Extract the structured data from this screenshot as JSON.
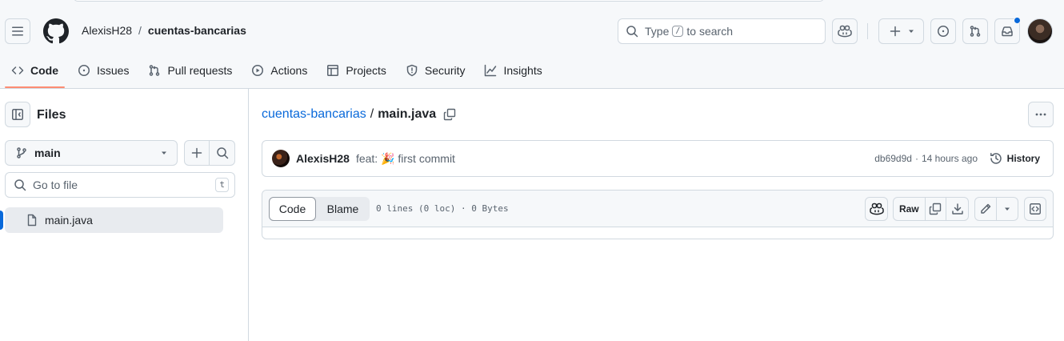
{
  "header": {
    "owner": "AlexisH28",
    "separator": "/",
    "repo": "cuentas-bancarias",
    "search_prefix": "Type",
    "search_key": "/",
    "search_suffix": "to search"
  },
  "tabs": [
    {
      "label": "Code",
      "icon": "code-icon"
    },
    {
      "label": "Issues",
      "icon": "issue-icon"
    },
    {
      "label": "Pull requests",
      "icon": "pull-request-icon"
    },
    {
      "label": "Actions",
      "icon": "play-icon"
    },
    {
      "label": "Projects",
      "icon": "table-icon"
    },
    {
      "label": "Security",
      "icon": "shield-icon"
    },
    {
      "label": "Insights",
      "icon": "graph-icon"
    }
  ],
  "sidebar": {
    "title": "Files",
    "branch": "main",
    "goto_placeholder": "Go to file",
    "goto_key": "t",
    "files": [
      {
        "name": "main.java"
      }
    ]
  },
  "main": {
    "path_repo": "cuentas-bancarias",
    "path_sep": "/",
    "path_file": "main.java",
    "commit": {
      "author": "AlexisH28",
      "message": "feat: 🎉 first commit",
      "hash": "db69d9d",
      "dot": "·",
      "time": "14 hours ago",
      "history_label": "History"
    },
    "file": {
      "tab_code": "Code",
      "tab_blame": "Blame",
      "info": "0 lines (0 loc) · 0 Bytes",
      "raw_label": "Raw"
    }
  },
  "colors": {
    "link": "#0969da",
    "tab_underline": "#fd8c73",
    "header_bg": "#f6f8fa",
    "border": "#d1d9e0"
  }
}
